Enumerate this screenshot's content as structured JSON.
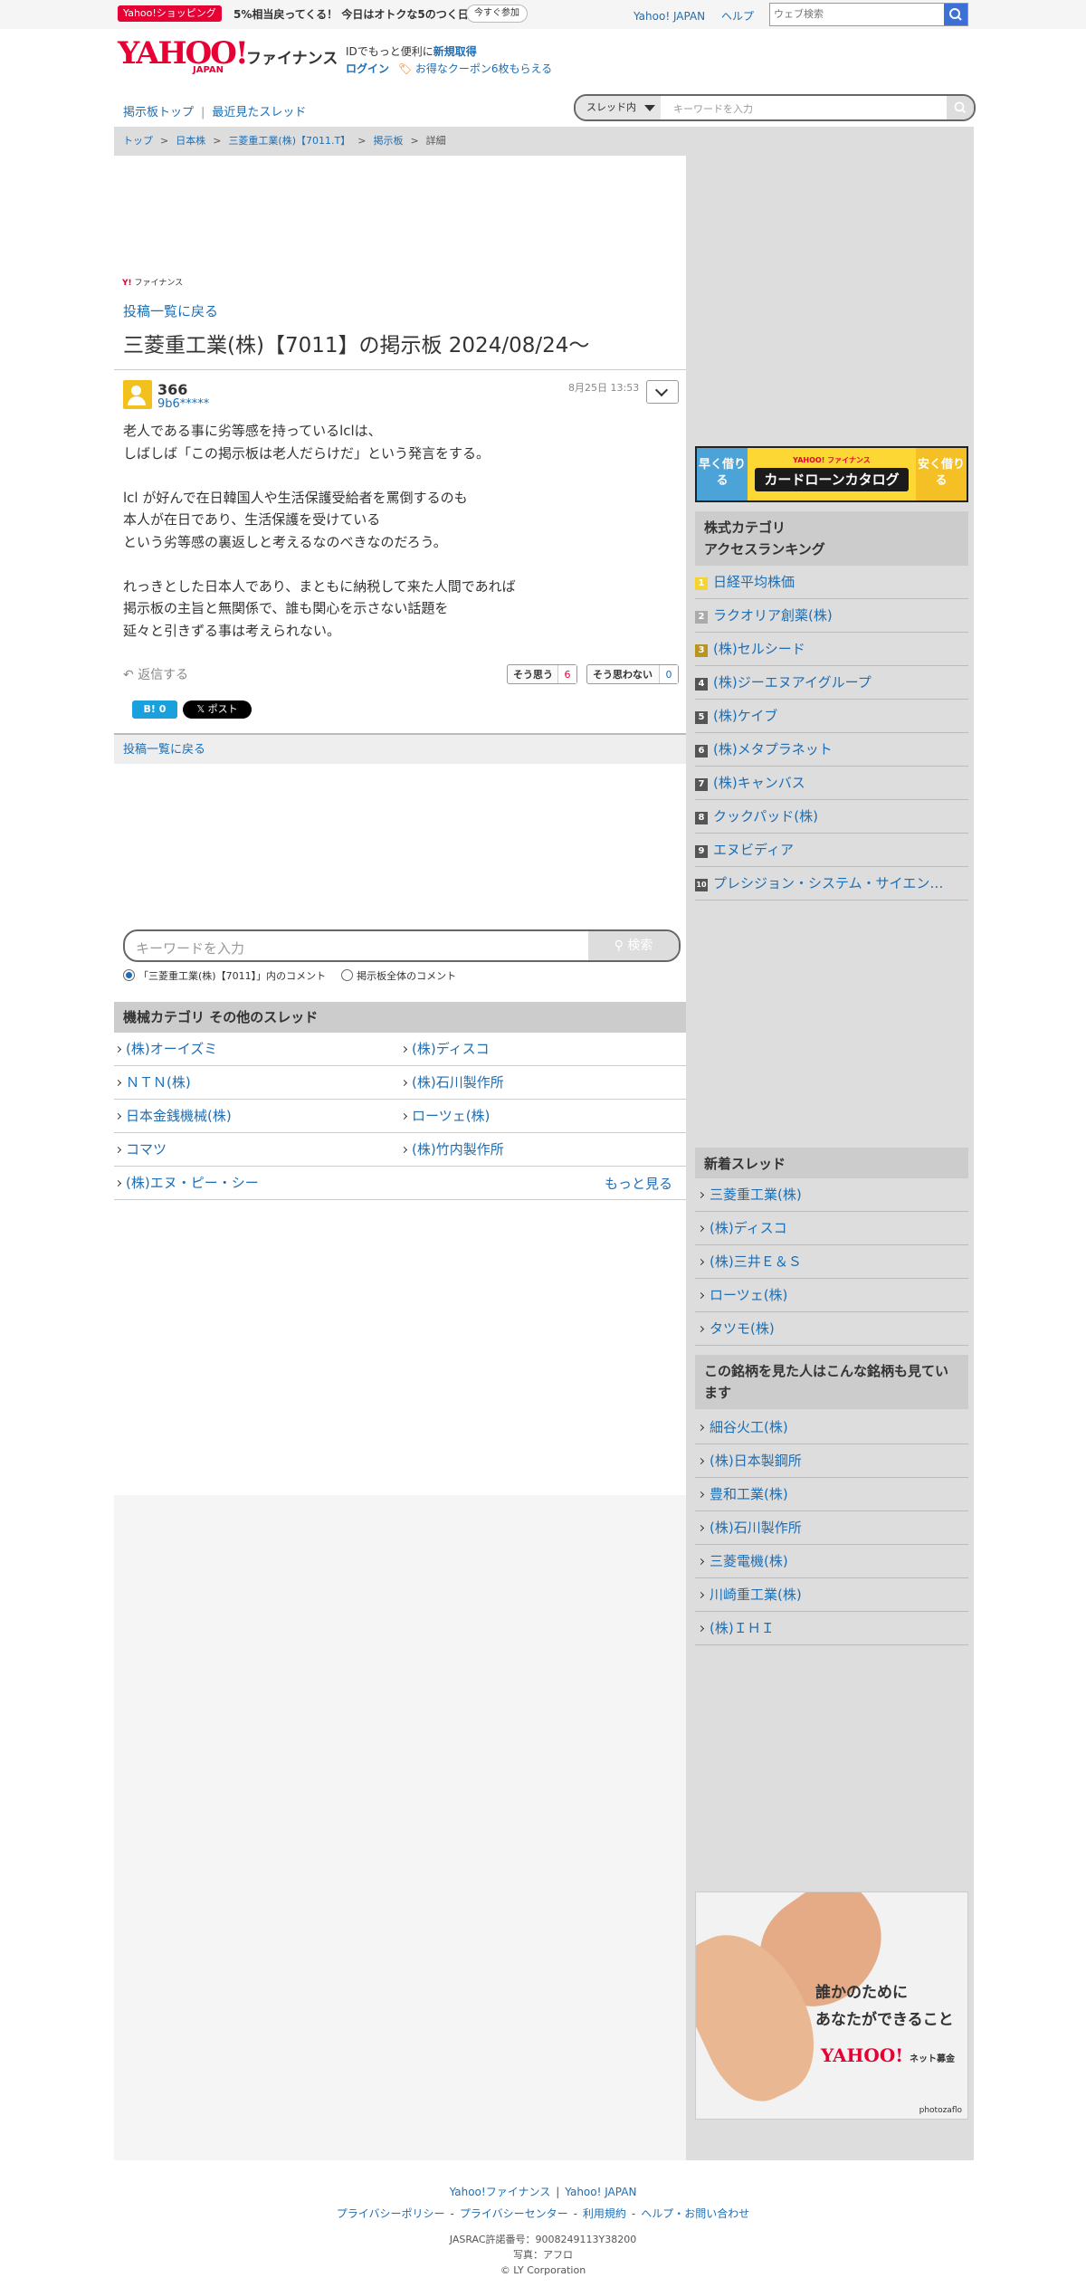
{
  "topbar": {
    "promo_tag": "Yahoo!ショッピング",
    "promo_text": "5%相当戻ってくる！ 今日はオトクな5のつく日",
    "promo_button": "今すぐ参加",
    "links": [
      "Yahoo! JAPAN",
      "ヘルプ"
    ],
    "web_search_placeholder": "ウェブ検索"
  },
  "header": {
    "logo_yahoo": "YAHOO!",
    "logo_japan": "JAPAN",
    "logo_finance": "ファイナンス",
    "id_text_prefix": "IDでもっと便利に",
    "id_text_link": "新規取得",
    "login": "ログイン",
    "coupon": "お得なクーポン6枚もらえる"
  },
  "nav": {
    "board_top": "掲示板トップ",
    "separator": "|",
    "recent_threads": "最近見たスレッド",
    "scope": "スレッド内",
    "keyword_placeholder": "キーワードを入力"
  },
  "breadcrumb": [
    "トップ",
    "日本株",
    "三菱重工業(株)【7011.T】",
    "掲示板",
    "詳細"
  ],
  "post": {
    "brand_mini": "ファイナンス",
    "back_to_list": "投稿一覧に戻る",
    "title": "三菱重工業(株)【7011】の掲示板 2024/08/24〜",
    "number": "366",
    "user": "9b6*****",
    "date": "8月25日 13:53",
    "body": [
      "老人である事に劣等感を持っているlclは、",
      "しばしば「この掲示板は老人だらけだ」という発言をする。",
      "",
      "lcl が好んで在日韓国人や生活保護受給者を罵倒するのも",
      "本人が在日であり、生活保護を受けている",
      "という劣等感の裏返しと考えるなのべきなのだろう。",
      "",
      "れっきとした日本人であり、まともに納税して来た人間であれば",
      "掲示板の主旨と無関係で、誰も関心を示さない話題を",
      "延々と引きずる事は考えられない。"
    ],
    "reply": "返信する",
    "agree_label": "そう思う",
    "agree_count": "6",
    "disagree_label": "そう思わない",
    "disagree_count": "0",
    "hatebu": "B! 0",
    "xpost": "𝕏 ポスト",
    "back_to_list_bar": "投稿一覧に戻る"
  },
  "comment_search": {
    "placeholder": "キーワードを入力",
    "button": "検索",
    "option_thread": "「三菱重工業(株)【7011】」内のコメント",
    "option_all": "掲示板全体のコメント"
  },
  "category": {
    "header": "機械カテゴリ  その他のスレッド",
    "items": [
      "(株)オーイズミ",
      "(株)ディスコ",
      "ＮＴＮ(株)",
      "(株)石川製作所",
      "日本金銭機械(株)",
      "ローツェ(株)",
      "コマツ",
      "(株)竹内製作所",
      "(株)エヌ・ピー・シー"
    ],
    "more": "もっと見る"
  },
  "sidebar": {
    "banner_left": "早く借りる",
    "banner_sub": "YAHOO! ファイナンス",
    "banner_main": "カードローンカタログ",
    "banner_right": "安く借りる",
    "ranking_title": "株式カテゴリ\nアクセスランキング",
    "ranking_title_1": "株式カテゴリ",
    "ranking_title_2": "アクセスランキング",
    "ranking": [
      "日経平均株価",
      "ラクオリア創薬(株)",
      "(株)セルシード",
      "(株)ジーエヌアイグループ",
      "(株)ケイブ",
      "(株)メタプラネット",
      "(株)キャンバス",
      "クックパッド(株)",
      "エヌビディア",
      "プレシジョン・システム・サイエン…"
    ],
    "ranking_nums": [
      "1",
      "2",
      "3",
      "4",
      "5",
      "6",
      "7",
      "8",
      "9",
      "10"
    ],
    "new_threads_title": "新着スレッド",
    "new_threads": [
      "三菱重工業(株)",
      "(株)ディスコ",
      "(株)三井Ｅ＆Ｓ",
      "ローツェ(株)",
      "タツモ(株)"
    ],
    "related_title": "この銘柄を見た人はこんな銘柄も見ています",
    "related": [
      "細谷火工(株)",
      "(株)日本製鋼所",
      "豊和工業(株)",
      "(株)石川製作所",
      "三菱電機(株)",
      "川崎重工業(株)",
      "(株)ＩＨＩ"
    ],
    "ad_line1": "誰かのために",
    "ad_line2": "あなたができること",
    "ad_brand": "YAHOO!",
    "ad_brand_sub": "ネット募金",
    "ad_credit": "photozaflo"
  },
  "footer": {
    "links1": [
      "Yahoo!ファイナンス",
      "Yahoo! JAPAN"
    ],
    "links2": [
      "プライバシーポリシー",
      "プライバシーセンター",
      "利用規約",
      "ヘルプ・お問い合わせ"
    ],
    "jasrac": "JASRAC許諾番号：9008249113Y38200",
    "photo": "写真：アフロ",
    "copyright": "© LY Corporation"
  }
}
